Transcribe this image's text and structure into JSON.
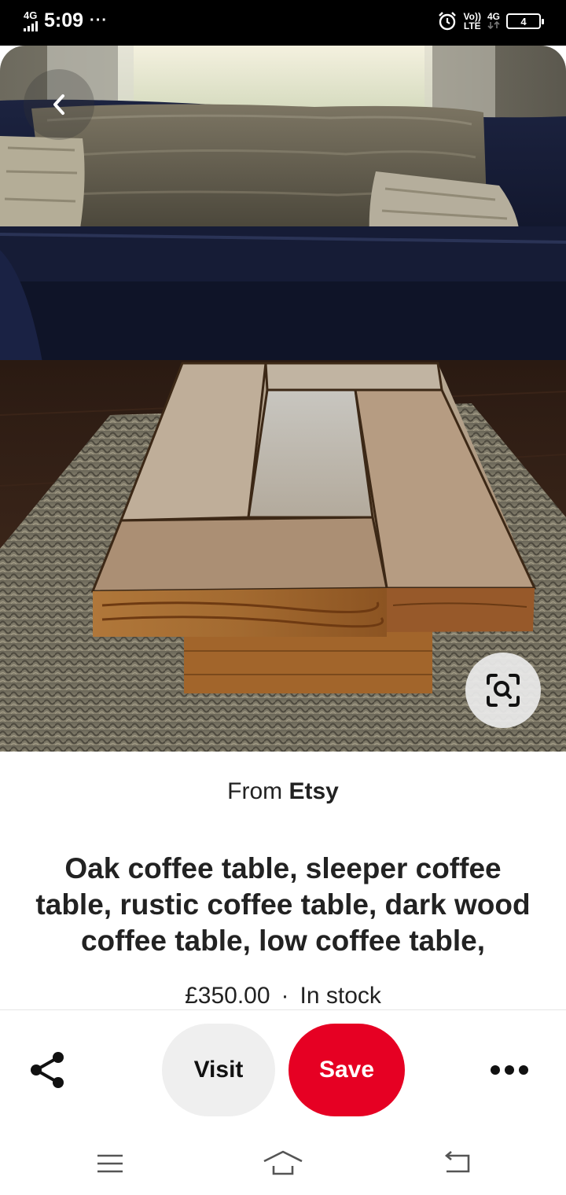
{
  "status_bar": {
    "network": "4G",
    "time": "5:09",
    "overflow": "···",
    "volte": "Vo))",
    "lte": "LTE",
    "network_right": "4G",
    "battery": "4"
  },
  "pin": {
    "source_prefix": "From",
    "source_name": "Etsy",
    "title": "Oak coffee table, sleeper coffee table, rustic coffee table, dark wood coffee table, low coffee table,",
    "price": "£350.00",
    "separator": "·",
    "stock": "In stock"
  },
  "actions": {
    "visit_label": "Visit",
    "save_label": "Save"
  },
  "colors": {
    "save": "#e60023",
    "visit": "#efefef"
  },
  "icons": [
    "back-arrow-icon",
    "visual-search-icon",
    "share-icon",
    "more-icon",
    "menu-icon",
    "home-icon",
    "back-icon",
    "alarm-icon"
  ]
}
